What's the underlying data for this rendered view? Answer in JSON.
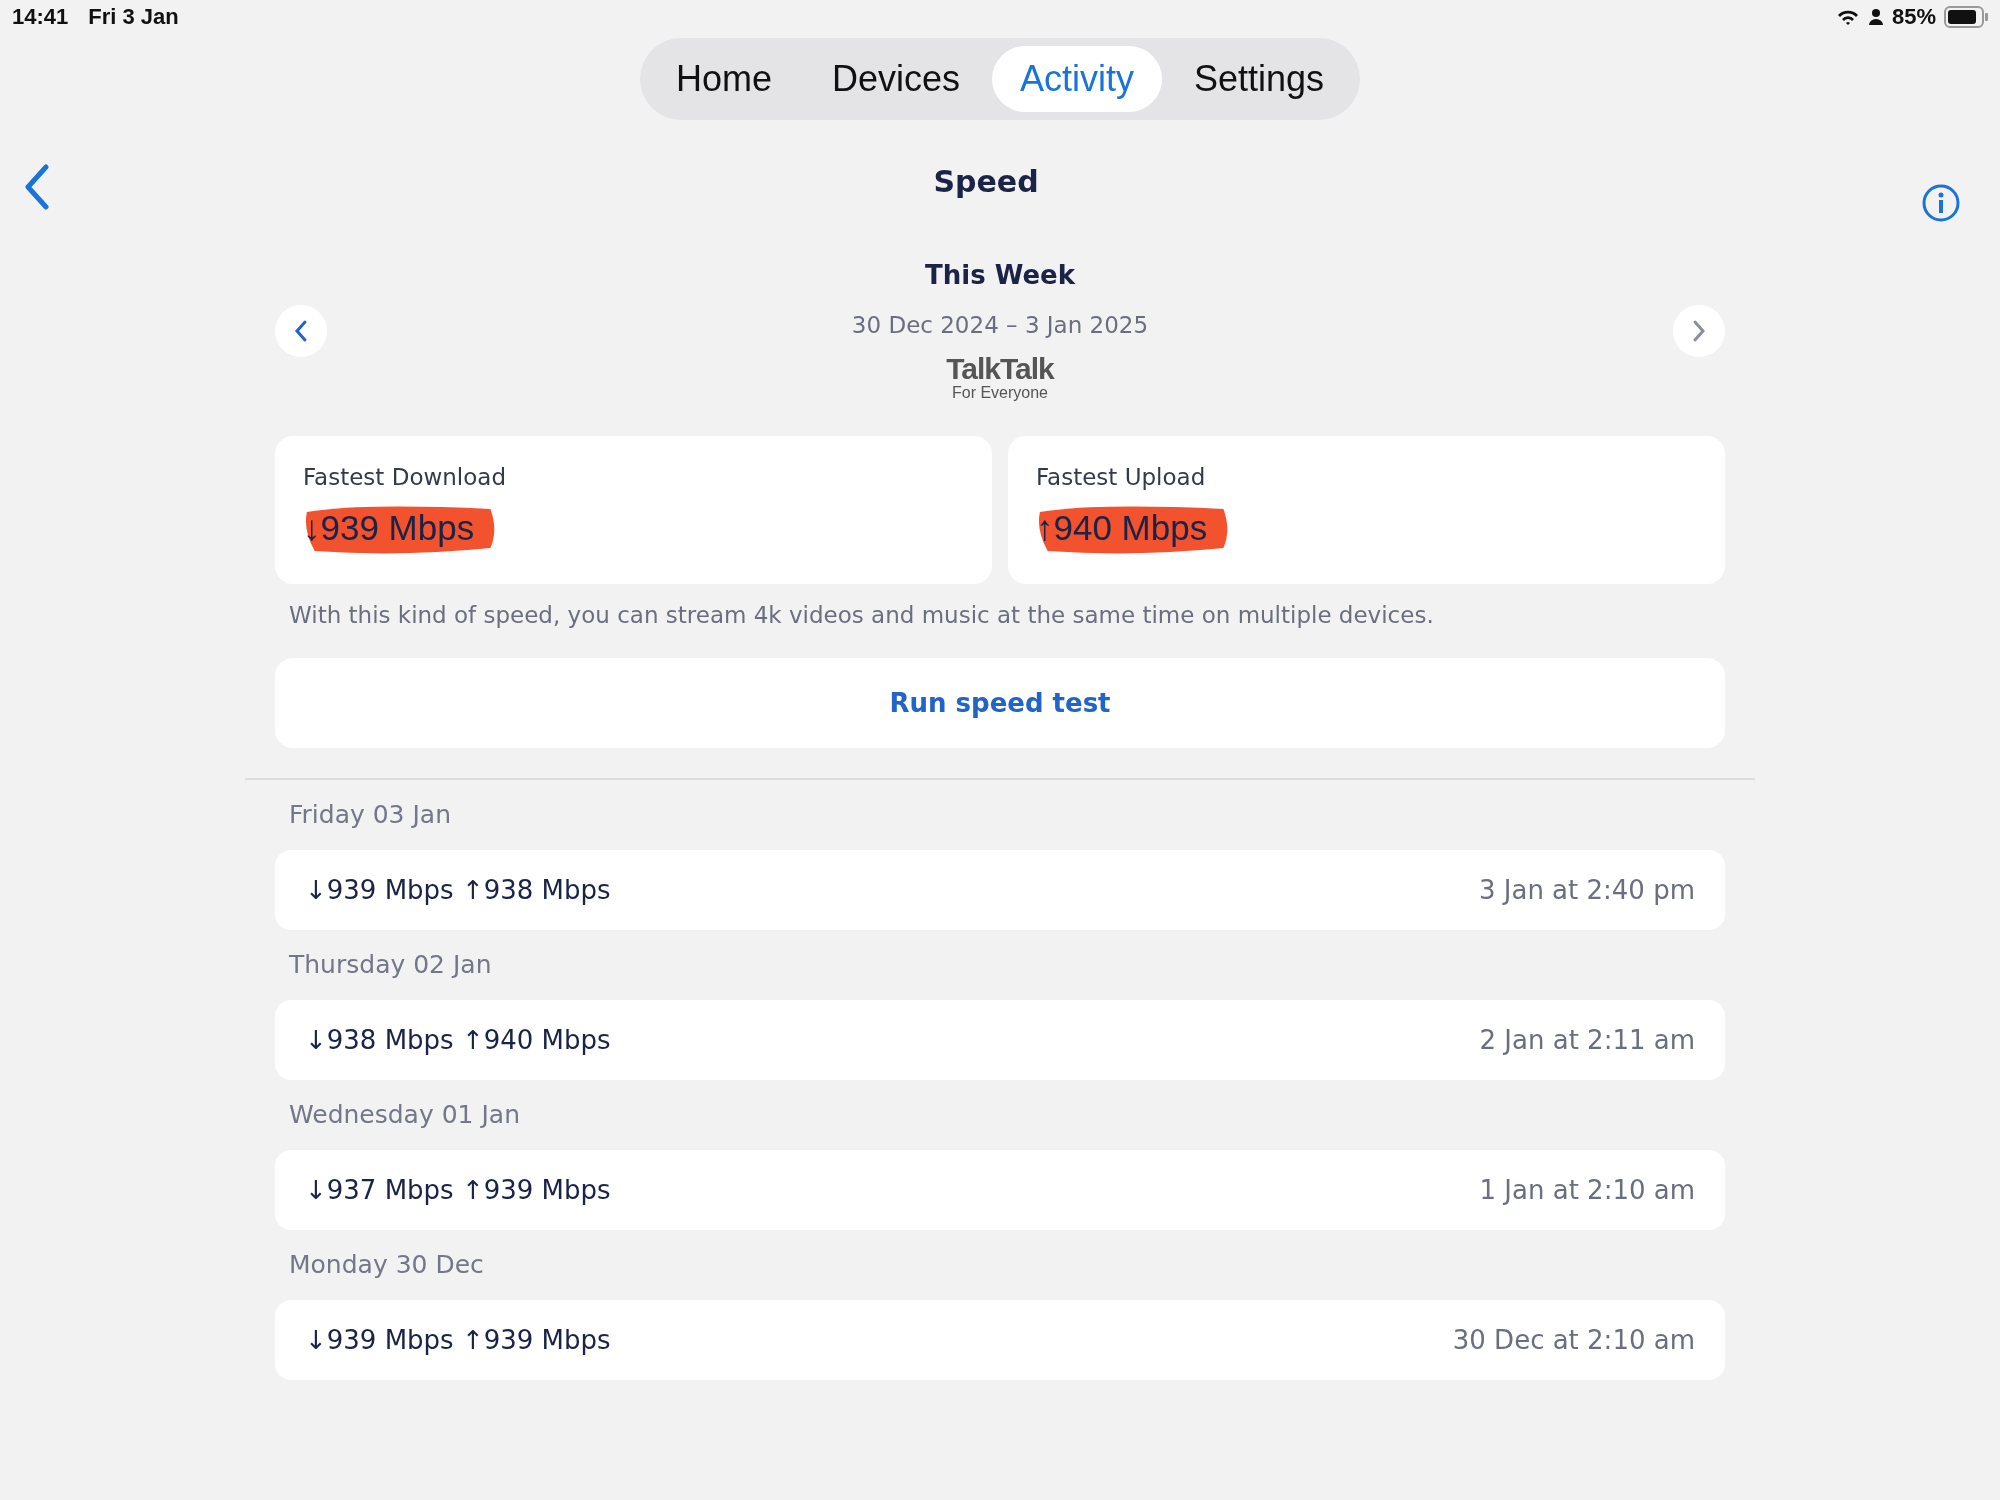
{
  "status_bar": {
    "time": "14:41",
    "date": "Fri 3 Jan",
    "battery": "85%"
  },
  "tabs": [
    {
      "label": "Home",
      "selected": false
    },
    {
      "label": "Devices",
      "selected": false
    },
    {
      "label": "Activity",
      "selected": true
    },
    {
      "label": "Settings",
      "selected": false
    }
  ],
  "title": "Speed",
  "period": {
    "title": "This Week",
    "range": "30 Dec 2024 – 3 Jan 2025"
  },
  "logo": {
    "name": "TalkTalk",
    "tagline": "For Everyone"
  },
  "summary": [
    {
      "label": "Fastest Download",
      "value": "↓939 Mbps",
      "highlighted": true
    },
    {
      "label": "Fastest Upload",
      "value": "↑940 Mbps",
      "highlighted": true
    }
  ],
  "note": "With this kind of speed, you can stream 4k videos and music at the same time on multiple devices.",
  "run_button": "Run speed test",
  "results": [
    {
      "day": "Friday 03 Jan",
      "speeds": "↓939 Mbps ↑938 Mbps",
      "time": "3 Jan at 2:40 pm"
    },
    {
      "day": "Thursday 02 Jan",
      "speeds": "↓938 Mbps ↑940 Mbps",
      "time": "2 Jan at 2:11 am"
    },
    {
      "day": "Wednesday 01 Jan",
      "speeds": "↓937 Mbps ↑939 Mbps",
      "time": "1 Jan at 2:10 am"
    },
    {
      "day": "Monday 30 Dec",
      "speeds": "↓939 Mbps ↑939 Mbps",
      "time": "30 Dec at 2:10 am"
    }
  ]
}
